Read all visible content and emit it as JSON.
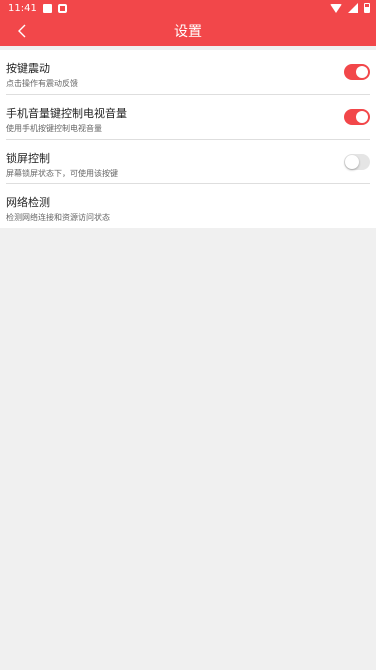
{
  "status_bar": {
    "time": "11:41",
    "icons": [
      "notification-square-icon",
      "settings-icon",
      "wifi-icon",
      "signal-icon",
      "battery-icon"
    ]
  },
  "header": {
    "title": "设置",
    "back_icon": "chevron-left-icon",
    "color": "#f2474a"
  },
  "settings": [
    {
      "title": "按键震动",
      "subtitle": "点击操作有震动反馈",
      "toggle": "on"
    },
    {
      "title": "手机音量键控制电视音量",
      "subtitle": "使用手机按键控制电视音量",
      "toggle": "on"
    },
    {
      "title": "锁屏控制",
      "subtitle": "屏幕锁屏状态下，可使用该按键",
      "toggle": "off"
    },
    {
      "title": "网络检测",
      "subtitle": "检测网络连接和资源访问状态"
    }
  ],
  "colors": {
    "accent": "#f2474a",
    "background": "#f0f0f0",
    "toggle_off": "#e5e5e5"
  }
}
